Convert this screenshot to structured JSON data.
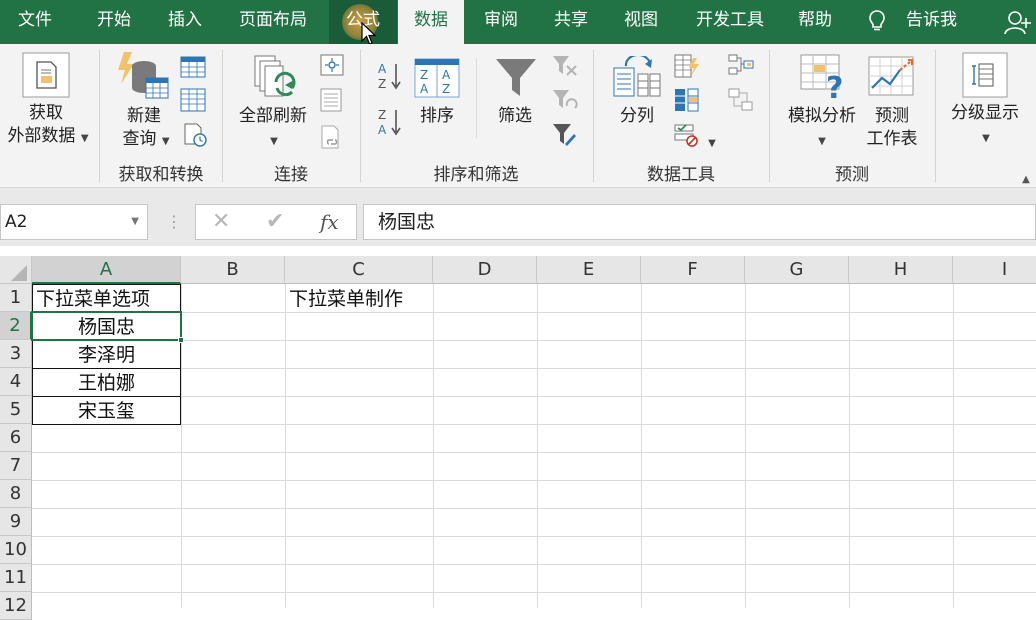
{
  "tabs": [
    {
      "label": "文件"
    },
    {
      "label": "开始"
    },
    {
      "label": "插入"
    },
    {
      "label": "页面布局"
    },
    {
      "label": "公式"
    },
    {
      "label": "数据"
    },
    {
      "label": "审阅"
    },
    {
      "label": "共享"
    },
    {
      "label": "视图"
    },
    {
      "label": "开发工具"
    },
    {
      "label": "帮助"
    },
    {
      "label": "告诉我"
    }
  ],
  "active_tab": "数据",
  "ribbon": {
    "get_external_line1": "获取",
    "get_external_line2": "外部数据",
    "new_query_line1": "新建",
    "new_query_line2": "查询",
    "group_get_transform": "获取和转换",
    "refresh_all": "全部刷新",
    "group_connections": "连接",
    "sort": "排序",
    "filter": "筛选",
    "group_sort_filter": "排序和筛选",
    "text_to_columns": "分列",
    "group_data_tools": "数据工具",
    "what_if_analysis": "模拟分析",
    "forecast_line1": "预测",
    "forecast_line2": "工作表",
    "group_forecast": "预测",
    "outline": "分级显示"
  },
  "formula_bar": {
    "name_box": "A2",
    "fx_label": "fx",
    "value": "杨国忠"
  },
  "columns": [
    "A",
    "B",
    "C",
    "D",
    "E",
    "F",
    "G",
    "H",
    "I"
  ],
  "rows": [
    "1",
    "2",
    "3",
    "4",
    "5",
    "6",
    "7",
    "8",
    "9",
    "10",
    "11",
    "12"
  ],
  "cells": {
    "A1": "下拉菜单选项",
    "A2": "杨国忠",
    "A3": "李泽明",
    "A4": "王柏娜",
    "A5": "宋玉玺",
    "C1": "下拉菜单制作"
  },
  "selected_cell": "A2",
  "colors": {
    "accent": "#217346",
    "ribbon_bg": "#f3f3f3"
  }
}
